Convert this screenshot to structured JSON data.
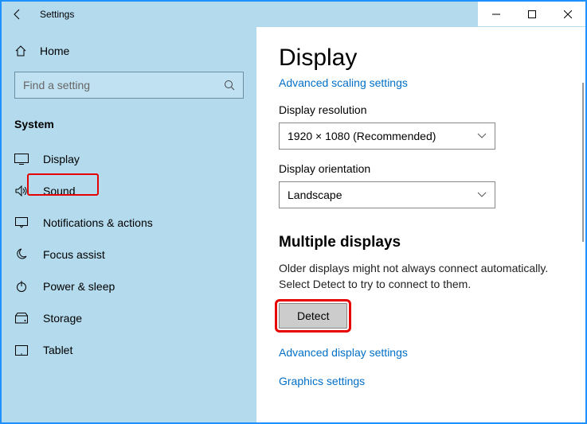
{
  "titlebar": {
    "title": "Settings"
  },
  "sidebar": {
    "home": "Home",
    "search_placeholder": "Find a setting",
    "category": "System",
    "items": [
      {
        "label": "Display"
      },
      {
        "label": "Sound"
      },
      {
        "label": "Notifications & actions"
      },
      {
        "label": "Focus assist"
      },
      {
        "label": "Power & sleep"
      },
      {
        "label": "Storage"
      },
      {
        "label": "Tablet"
      }
    ]
  },
  "main": {
    "heading": "Display",
    "link_scaling": "Advanced scaling settings",
    "resolution_label": "Display resolution",
    "resolution_value": "1920 × 1080 (Recommended)",
    "orientation_label": "Display orientation",
    "orientation_value": "Landscape",
    "multi_head": "Multiple displays",
    "multi_desc": "Older displays might not always connect automatically. Select Detect to try to connect to them.",
    "detect": "Detect",
    "link_adv": "Advanced display settings",
    "link_gfx": "Graphics settings"
  }
}
